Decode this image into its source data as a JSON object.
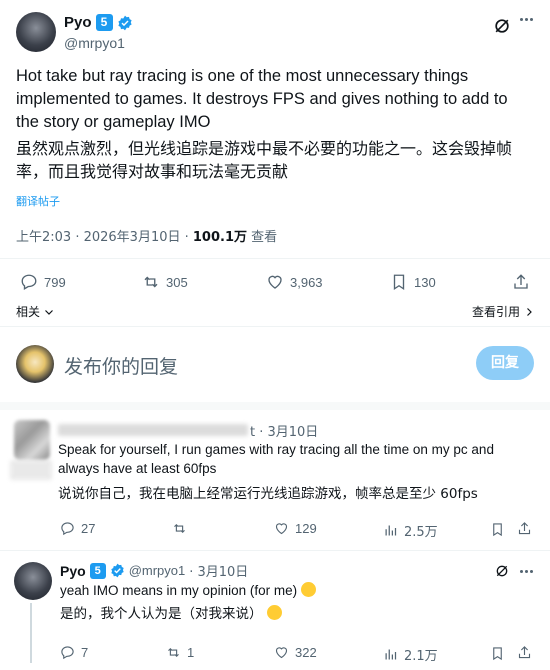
{
  "main_tweet": {
    "author_name": "Pyo",
    "badge": "5",
    "handle": "@mrpyo1",
    "text_en": "Hot take but ray tracing is one of the most unnecessary things implemented to games. It destroys FPS and gives nothing to add to the story or gameplay IMO",
    "text_zh": "虽然观点激烈，但光线追踪是游戏中最不必要的功能之一。这会毁掉帧率，而且我觉得对故事和玩法毫无贡献",
    "translate_label": "翻译帖子",
    "timestamp": "上午2:03 · 2026年3月10日 · ",
    "views_count": "100.1万",
    "views_label": " 查看",
    "stats": {
      "replies": "799",
      "retweets": "305",
      "likes": "3,963",
      "bookmarks": "130"
    },
    "related_label": "相关",
    "view_quotes_label": "查看引用"
  },
  "compose": {
    "placeholder": "发布你的回复",
    "reply_button": "回复"
  },
  "replies": [
    {
      "date": "t · 3月10日",
      "text_en": "Speak for yourself, I run games with ray tracing all the time on my pc and always have at least 60fps",
      "text_zh": "说说你自己，我在电脑上经常运行光线追踪游戏，帧率总是至少 60fps",
      "stats": {
        "replies": "27",
        "retweets": "",
        "likes": "129",
        "views": "2.5万"
      }
    },
    {
      "author_name": "Pyo",
      "badge": "5",
      "handle": "@mrpyo1",
      "date": "· 3月10日",
      "text_en": "yeah IMO means in my opinion (for me)",
      "text_zh": "是的，我个人认为是（对我来说）",
      "stats": {
        "replies": "7",
        "retweets": "1",
        "likes": "322",
        "views": "2.1万"
      }
    }
  ]
}
